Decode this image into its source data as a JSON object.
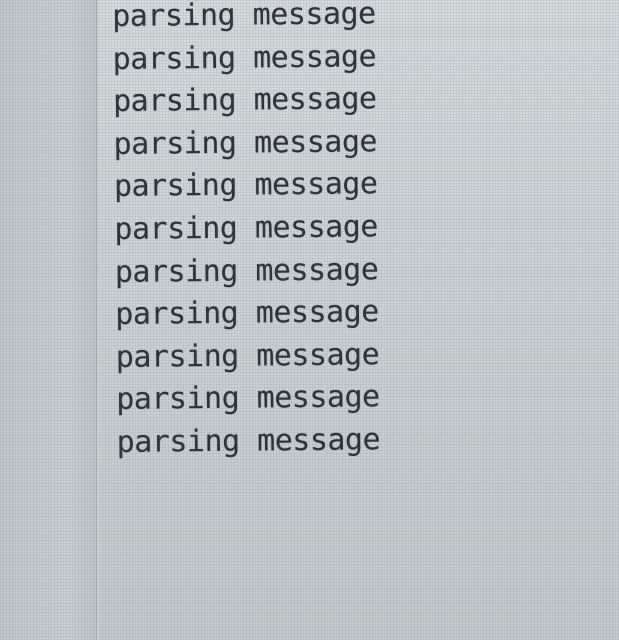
{
  "console": {
    "lines": [
      "parsing message",
      "parsing message",
      "parsing message",
      "parsing message",
      "parsing message",
      "parsing message",
      "parsing message",
      "parsing message",
      "parsing message",
      "parsing message",
      "parsing message"
    ]
  },
  "colors": {
    "text": "#2b3236",
    "background": "#cdd2d5"
  }
}
